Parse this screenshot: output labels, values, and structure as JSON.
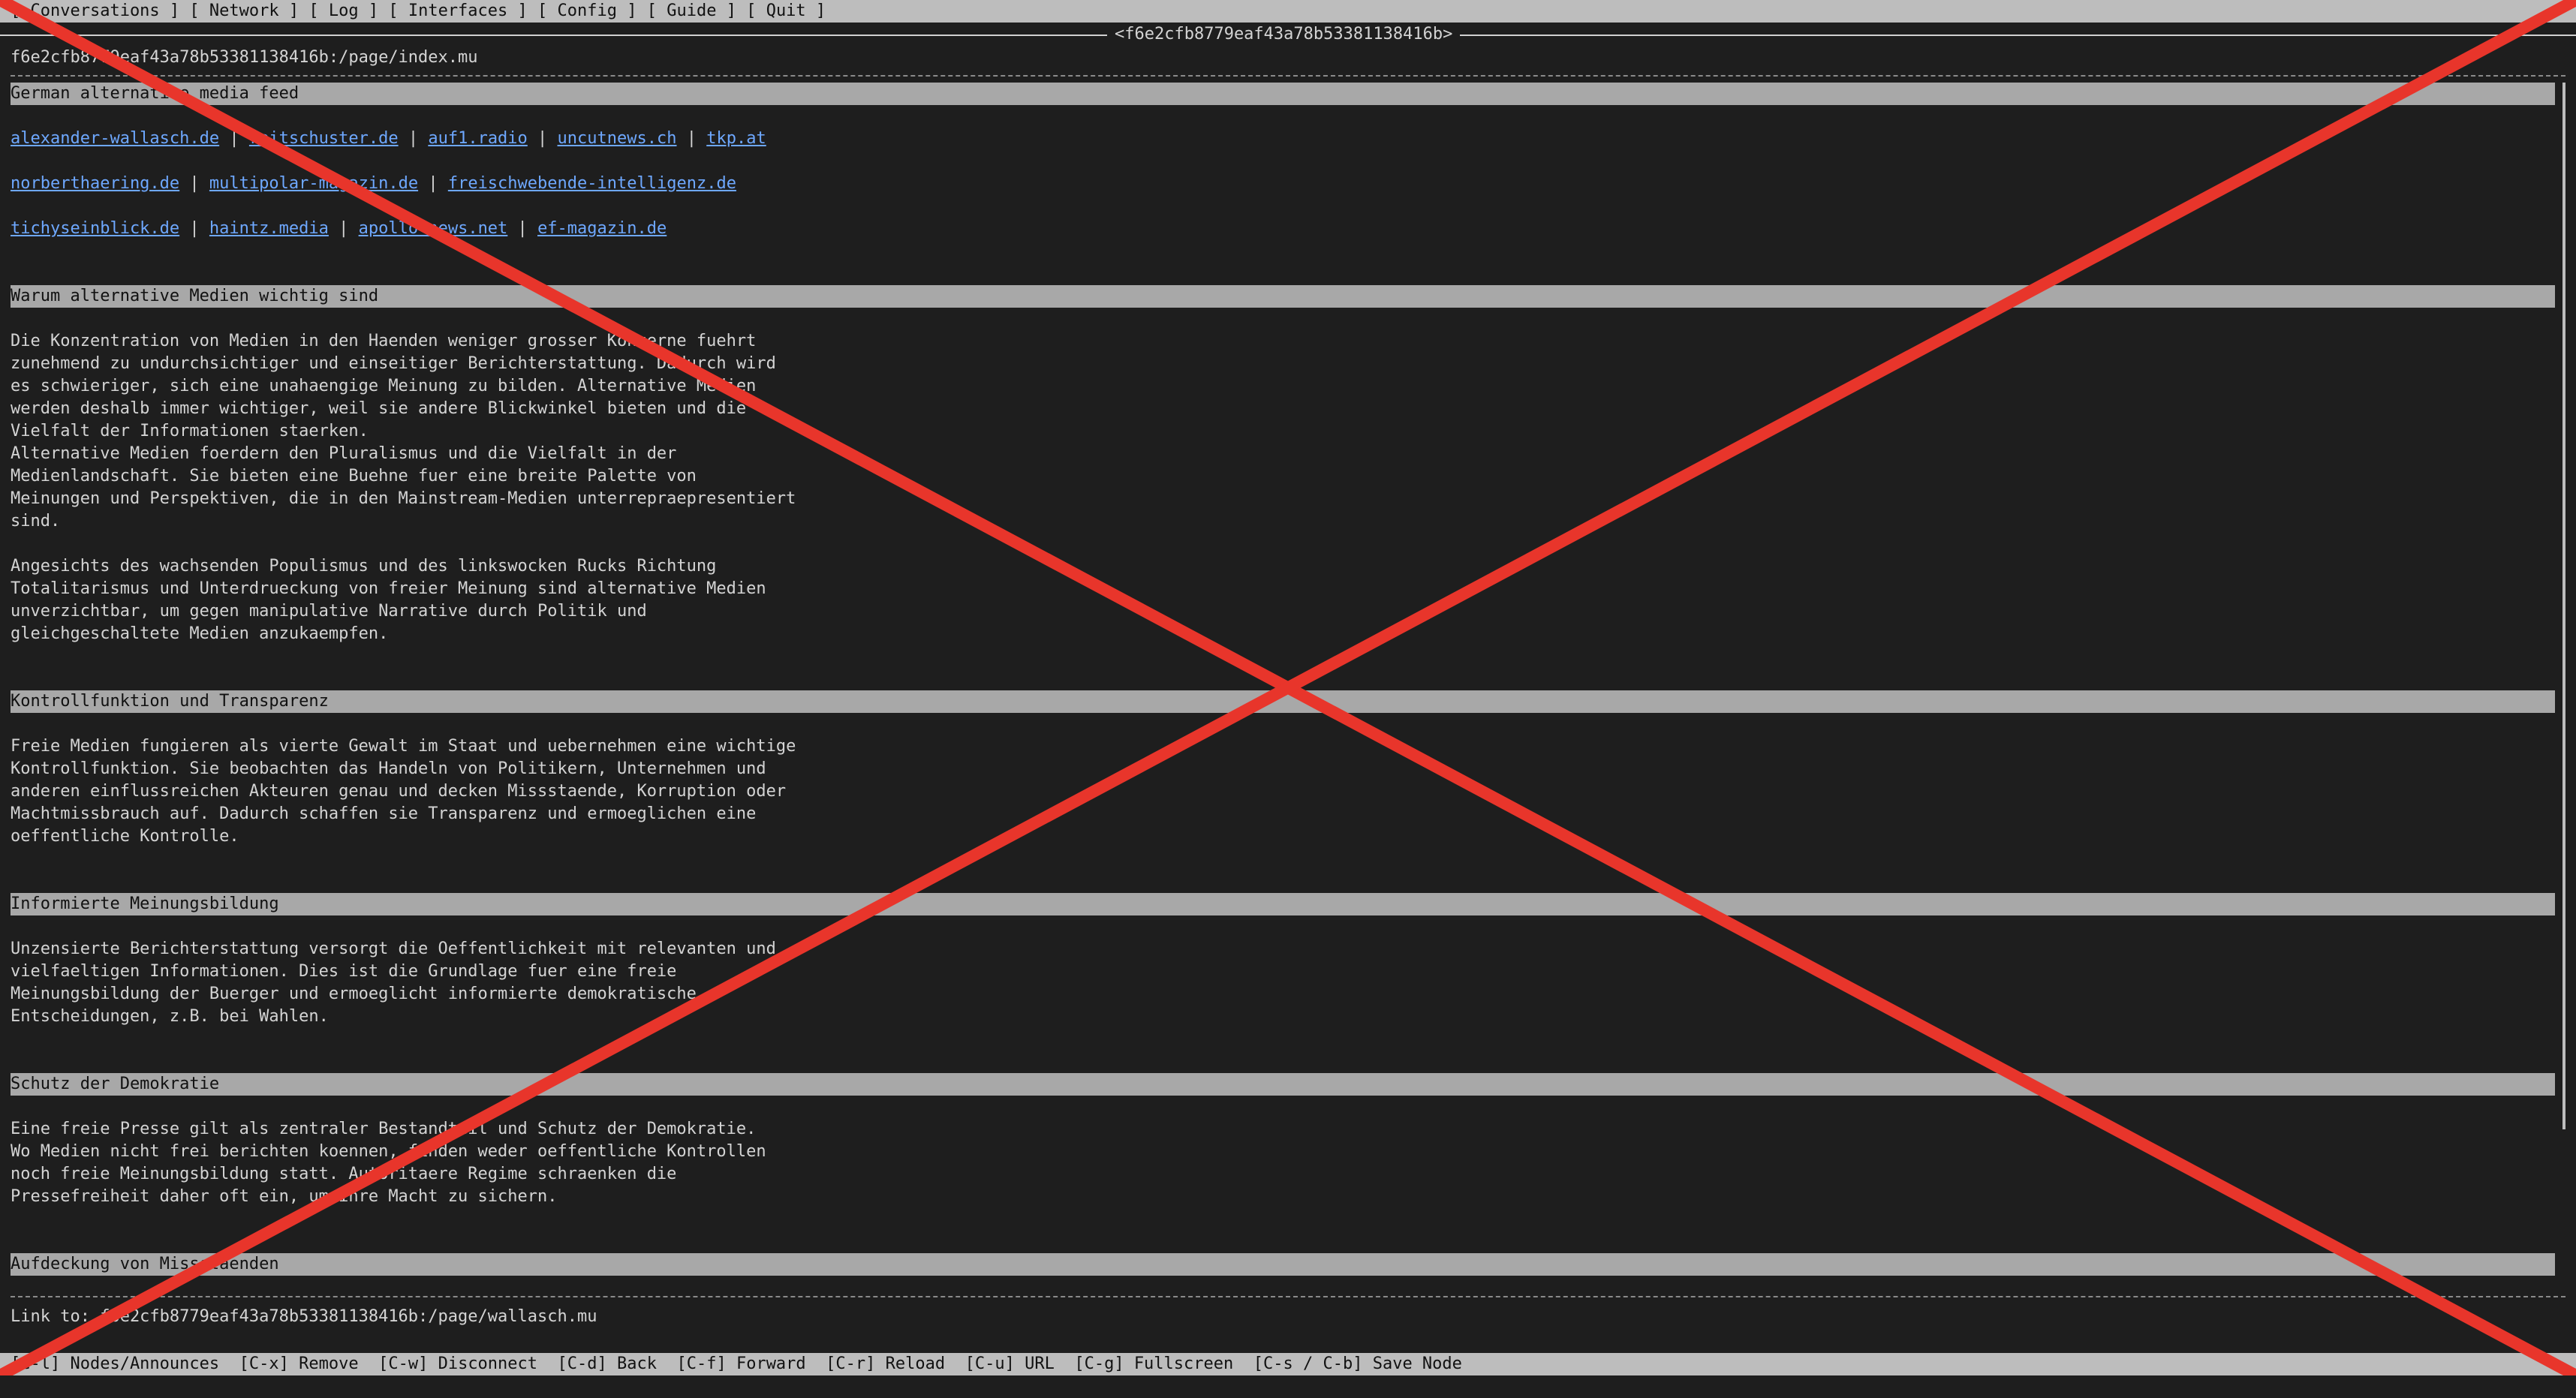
{
  "menu": [
    "[ Conversations ]",
    "[ Network ]",
    "[ Log ]",
    "[ Interfaces ]",
    "[ Config ]",
    "[ Guide ]",
    "[ Quit ]"
  ],
  "window_title": "<f6e2cfb8779eaf43a78b53381138416b>",
  "page_url": "f6e2cfb8779eaf43a78b53381138416b:/page/index.mu",
  "lines": [
    {
      "type": "heading",
      "text": "German alternative media feed"
    },
    {
      "type": "blank"
    },
    {
      "type": "links",
      "items": [
        "alexander-wallasch.de",
        "reitschuster.de",
        "auf1.radio",
        "uncutnews.ch",
        "tkp.at"
      ]
    },
    {
      "type": "blank"
    },
    {
      "type": "links",
      "items": [
        "norberthaering.de",
        "multipolar-magazin.de",
        "freischwebende-intelligenz.de"
      ]
    },
    {
      "type": "blank"
    },
    {
      "type": "links",
      "items": [
        "tichyseinblick.de",
        "haintz.media",
        "apollo-news.net",
        "ef-magazin.de"
      ]
    },
    {
      "type": "blank"
    },
    {
      "type": "blank"
    },
    {
      "type": "heading",
      "text": "Warum alternative Medien wichtig sind"
    },
    {
      "type": "blank"
    },
    {
      "type": "text",
      "text": "Die Konzentration von Medien in den Haenden weniger grosser Konzerne fuehrt"
    },
    {
      "type": "text",
      "text": "zunehmend zu undurchsichtiger und einseitiger Berichterstattung. Dadurch wird"
    },
    {
      "type": "text",
      "text": "es schwieriger, sich eine unahaengige Meinung zu bilden. Alternative Medien"
    },
    {
      "type": "text",
      "text": "werden deshalb immer wichtiger, weil sie andere Blickwinkel bieten und die"
    },
    {
      "type": "text",
      "text": "Vielfalt der Informationen staerken."
    },
    {
      "type": "text",
      "text": "Alternative Medien foerdern den Pluralismus und die Vielfalt in der"
    },
    {
      "type": "text",
      "text": "Medienlandschaft. Sie bieten eine Buehne fuer eine breite Palette von"
    },
    {
      "type": "text",
      "text": "Meinungen und Perspektiven, die in den Mainstream-Medien unterrepraepresentiert"
    },
    {
      "type": "text",
      "text": "sind."
    },
    {
      "type": "blank"
    },
    {
      "type": "text",
      "text": "Angesichts des wachsenden Populismus und des linkswocken Rucks Richtung"
    },
    {
      "type": "text",
      "text": "Totalitarismus und Unterdrueckung von freier Meinung sind alternative Medien"
    },
    {
      "type": "text",
      "text": "unverzichtbar, um gegen manipulative Narrative durch Politik und"
    },
    {
      "type": "text",
      "text": "gleichgeschaltete Medien anzukaempfen."
    },
    {
      "type": "blank"
    },
    {
      "type": "blank"
    },
    {
      "type": "heading",
      "text": "Kontrollfunktion und Transparenz"
    },
    {
      "type": "blank"
    },
    {
      "type": "text",
      "text": "Freie Medien fungieren als vierte Gewalt im Staat und uebernehmen eine wichtige"
    },
    {
      "type": "text",
      "text": "Kontrollfunktion. Sie beobachten das Handeln von Politikern, Unternehmen und"
    },
    {
      "type": "text",
      "text": "anderen einflussreichen Akteuren genau und decken Missstaende, Korruption oder"
    },
    {
      "type": "text",
      "text": "Machtmissbrauch auf. Dadurch schaffen sie Transparenz und ermoeglichen eine"
    },
    {
      "type": "text",
      "text": "oeffentliche Kontrolle."
    },
    {
      "type": "blank"
    },
    {
      "type": "blank"
    },
    {
      "type": "heading",
      "text": "Informierte Meinungsbildung"
    },
    {
      "type": "blank"
    },
    {
      "type": "text",
      "text": "Unzensierte Berichterstattung versorgt die Oeffentlichkeit mit relevanten und"
    },
    {
      "type": "text",
      "text": "vielfaeltigen Informationen. Dies ist die Grundlage fuer eine freie"
    },
    {
      "type": "text",
      "text": "Meinungsbildung der Buerger und ermoeglicht informierte demokratische"
    },
    {
      "type": "text",
      "text": "Entscheidungen, z.B. bei Wahlen."
    },
    {
      "type": "blank"
    },
    {
      "type": "blank"
    },
    {
      "type": "heading",
      "text": "Schutz der Demokratie"
    },
    {
      "type": "blank"
    },
    {
      "type": "text",
      "text": "Eine freie Presse gilt als zentraler Bestandteil und Schutz der Demokratie."
    },
    {
      "type": "text",
      "text": "Wo Medien nicht frei berichten koennen, finden weder oeffentliche Kontrollen"
    },
    {
      "type": "text",
      "text": "noch freie Meinungsbildung statt. Autoritaere Regime schraenken die"
    },
    {
      "type": "text",
      "text": "Pressefreiheit daher oft ein, um ihre Macht zu sichern."
    },
    {
      "type": "blank"
    },
    {
      "type": "blank"
    },
    {
      "type": "heading",
      "text": "Aufdeckung von Missstaenden"
    }
  ],
  "status_link": "Link to: f6e2cfb8779eaf43a78b53381138416b:/page/wallasch.mu",
  "shortcuts": [
    "[C-l] Nodes/Announces",
    "[C-x] Remove",
    "[C-w] Disconnect",
    "[C-d] Back",
    "[C-f] Forward",
    "[C-r] Reload",
    "[C-u] URL",
    "[C-g] Fullscreen",
    "[C-s / C-b] Save Node"
  ],
  "colors": {
    "background": "#1e1e1e",
    "bar": "#bdbdbd",
    "heading": "#a8a8a8",
    "link": "#6ea8ff",
    "cross": "#e8352b"
  }
}
